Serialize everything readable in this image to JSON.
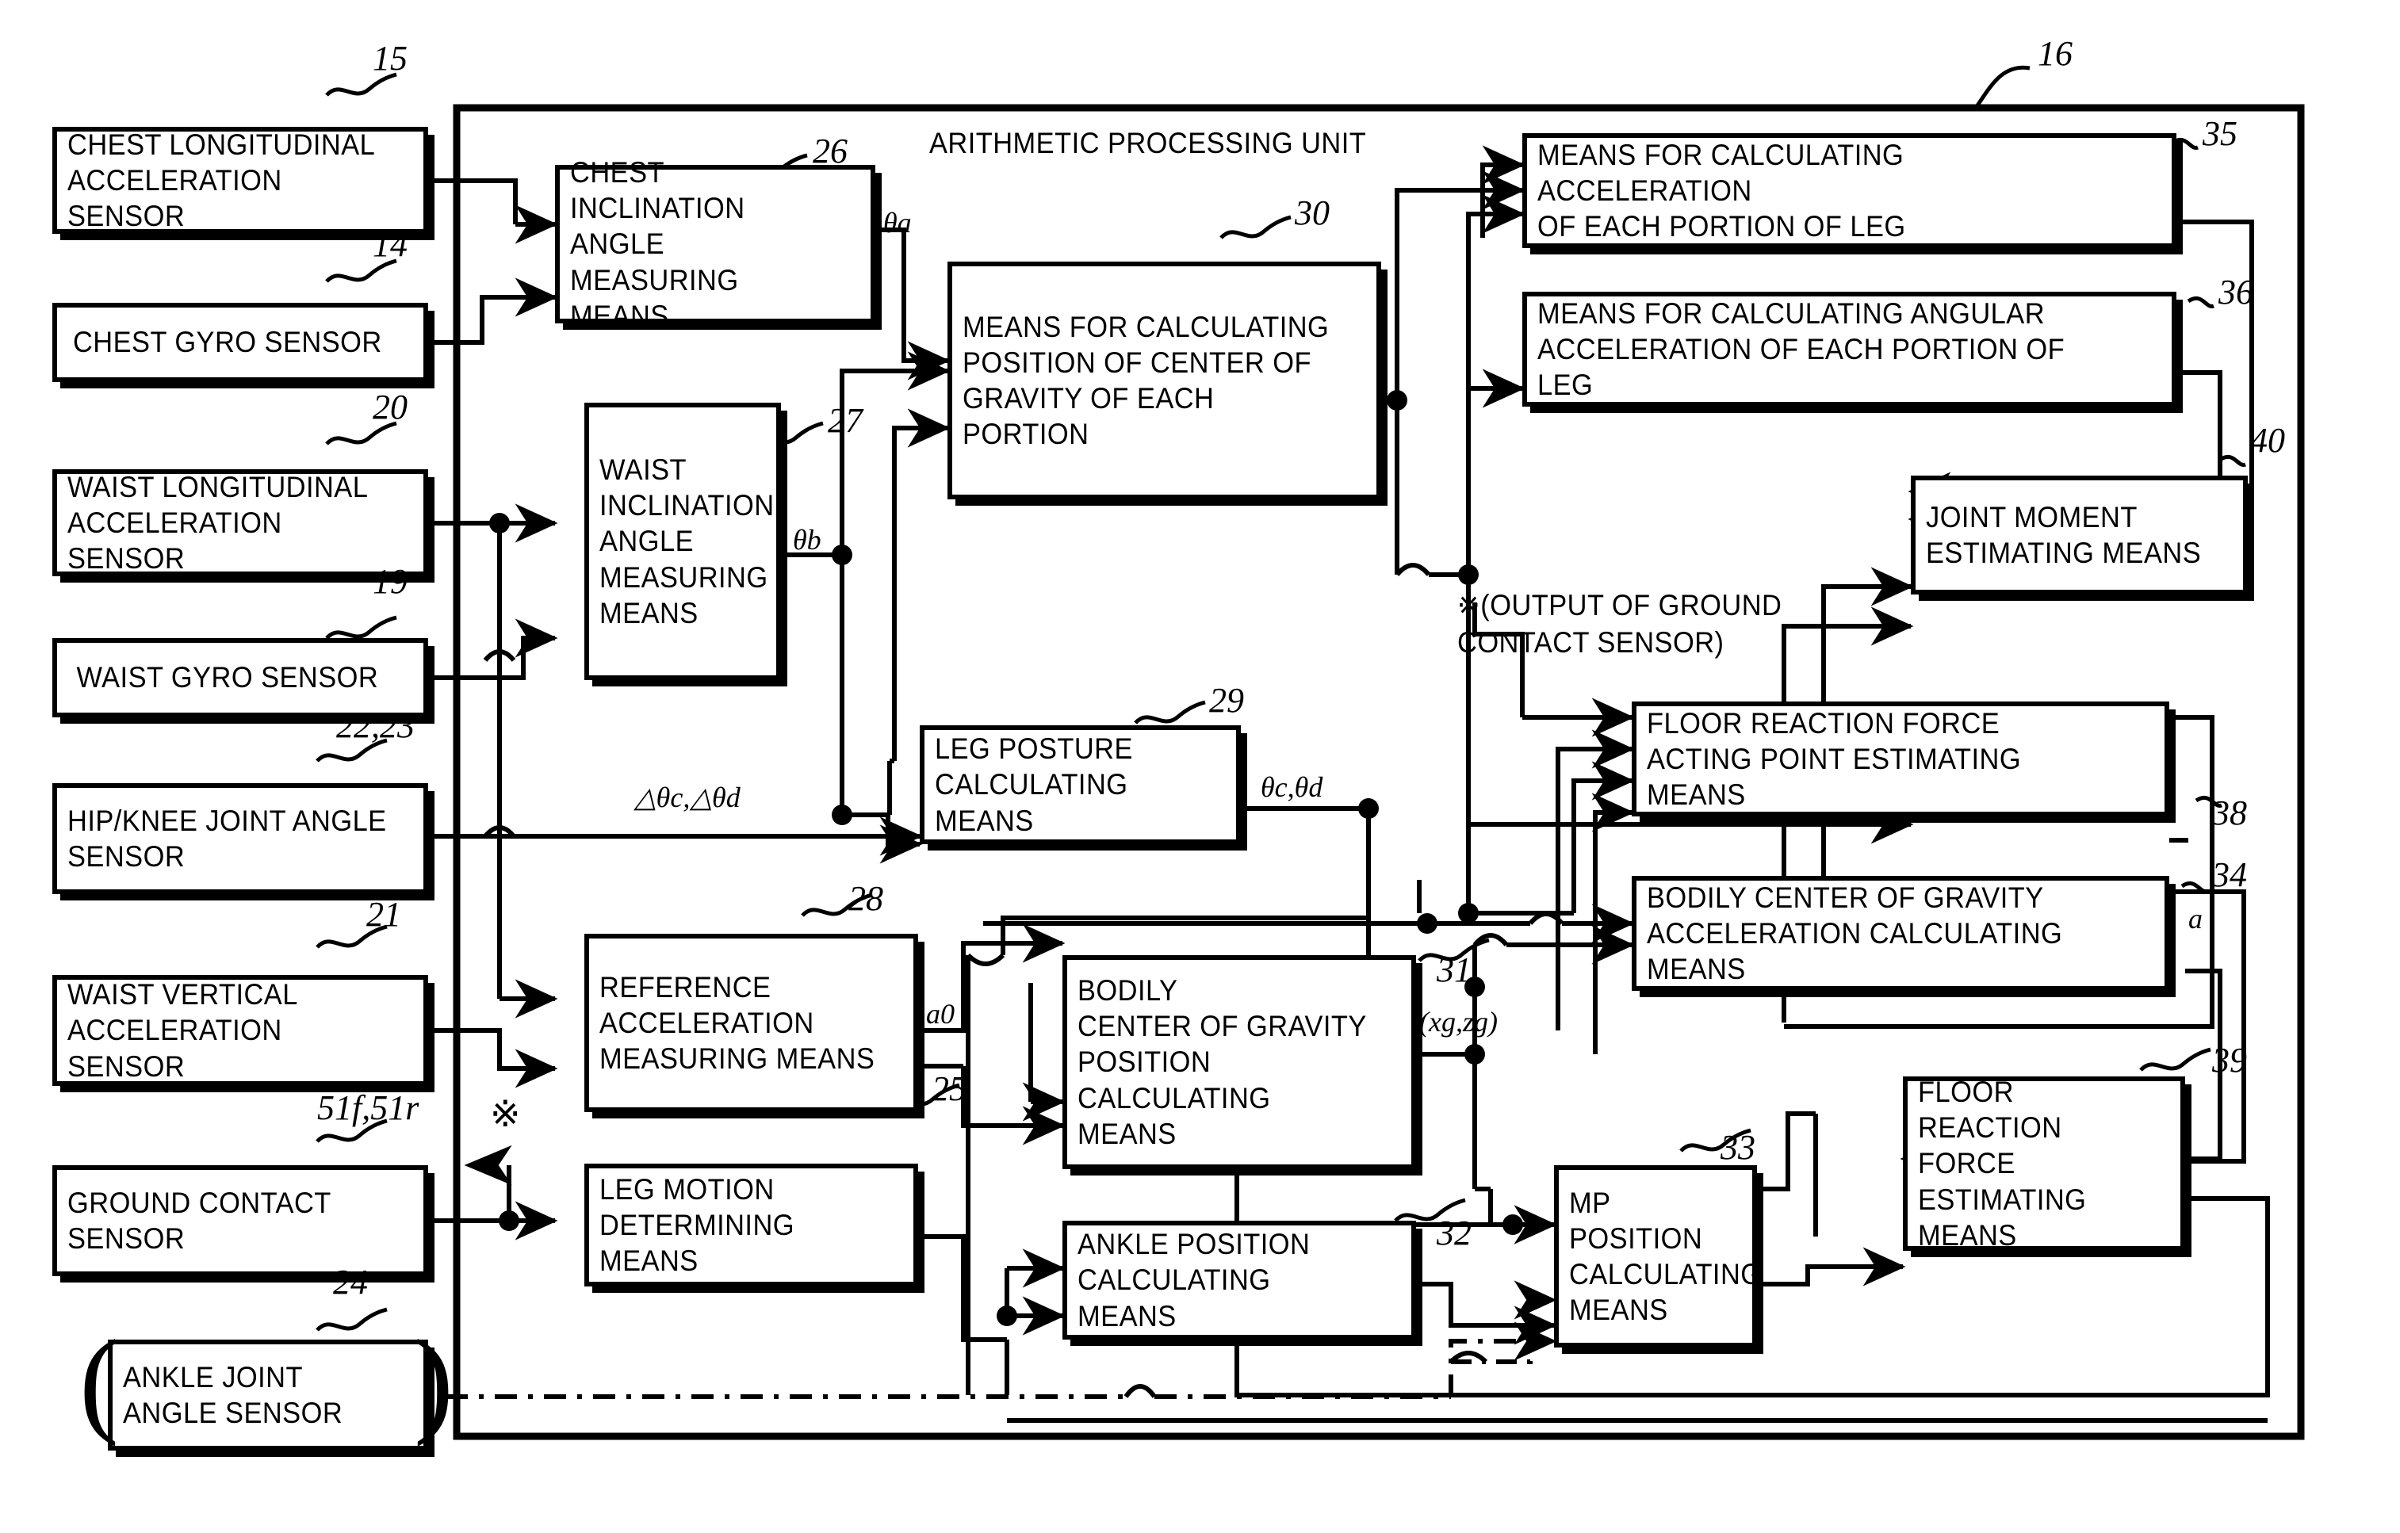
{
  "title_label": "ARITHMETIC PROCESSING UNIT",
  "unit_ref": "16",
  "sensors": [
    {
      "id": "chest-longitudinal-acceleration-sensor",
      "label": "CHEST LONGITUDINAL\nACCELERATION SENSOR",
      "ref": "15"
    },
    {
      "id": "chest-gyro-sensor",
      "label": "CHEST GYRO SENSOR",
      "ref": "14"
    },
    {
      "id": "waist-longitudinal-acceleration-sensor",
      "label": "WAIST LONGITUDINAL\nACCELERATION SENSOR",
      "ref": "20"
    },
    {
      "id": "waist-gyro-sensor",
      "label": "WAIST GYRO SENSOR",
      "ref": "19"
    },
    {
      "id": "hip-knee-joint-angle-sensor",
      "label": "HIP/KNEE JOINT ANGLE\nSENSOR",
      "ref": "22,23"
    },
    {
      "id": "waist-vertical-acceleration-sensor",
      "label": "WAIST VERTICAL\nACCELERATION SENSOR",
      "ref": "21"
    },
    {
      "id": "ground-contact-sensor",
      "label": "GROUND CONTACT\nSENSOR",
      "ref": "51f,51r"
    },
    {
      "id": "ankle-joint-angle-sensor",
      "label": "ANKLE JOINT\nANGLE SENSOR",
      "ref": "24"
    }
  ],
  "blocks": [
    {
      "id": "chest-inclination-angle-measuring-means",
      "label": "CHEST INCLINATION\nANGLE MEASURING\nMEANS",
      "ref": "26"
    },
    {
      "id": "waist-inclination-angle-measuring-means",
      "label": "WAIST\nINCLINATION\nANGLE\nMEASURING\nMEANS",
      "ref": "27"
    },
    {
      "id": "means-for-calculating-position-of-center-of-gravity-of-each-portion",
      "label": "MEANS FOR CALCULATING\nPOSITION OF CENTER OF\nGRAVITY OF EACH PORTION",
      "ref": "30"
    },
    {
      "id": "means-for-calculating-acceleration-of-each-portion-of-leg",
      "label": "MEANS FOR CALCULATING ACCELERATION\nOF EACH PORTION OF LEG",
      "ref": "35"
    },
    {
      "id": "means-for-calculating-angular-acceleration-of-each-portion-of-leg",
      "label": "MEANS FOR CALCULATING ANGULAR\nACCELERATION OF EACH PORTION OF LEG",
      "ref": "36"
    },
    {
      "id": "joint-moment-estimating-means",
      "label": "JOINT MOMENT\nESTIMATING MEANS",
      "ref": "40"
    },
    {
      "id": "leg-posture-calculating-means",
      "label": "LEG POSTURE\nCALCULATING MEANS",
      "ref": "29"
    },
    {
      "id": "floor-reaction-force-acting-point-estimating-means",
      "label": "FLOOR REACTION FORCE\nACTING POINT ESTIMATING MEANS",
      "ref": "38"
    },
    {
      "id": "bodily-center-of-gravity-acceleration-calculating-means",
      "label": "BODILY CENTER OF GRAVITY\nACCELERATION CALCULATING MEANS",
      "ref": "34"
    },
    {
      "id": "reference-acceleration-measuring-means",
      "label": "REFERENCE\nACCELERATION\nMEASURING MEANS",
      "ref": "28"
    },
    {
      "id": "bodily-center-of-gravity-position-calculating-means",
      "label": "BODILY\nCENTER OF GRAVITY\nPOSITION\nCALCULATING MEANS",
      "ref": "31"
    },
    {
      "id": "leg-motion-determining-means",
      "label": "LEG MOTION\nDETERMINING MEANS",
      "ref": "25"
    },
    {
      "id": "ankle-position-calculating-means",
      "label": "ANKLE POSITION\nCALCULATING MEANS",
      "ref": "32"
    },
    {
      "id": "mp-position-calculating-means",
      "label": "MP POSITION\nCALCULATING\nMEANS",
      "ref": "33"
    },
    {
      "id": "floor-reaction-force-estimating-means",
      "label": "FLOOR REACTION\nFORCE ESTIMATING\nMEANS",
      "ref": "39"
    }
  ],
  "signal_labels": {
    "theta_a": "θa",
    "theta_b": "θb",
    "delta_theta_cd": "△θc,△θd",
    "theta_cd": "θc,θd",
    "a0": "a0",
    "xg_zg": "(xg,zg)",
    "a": "a"
  },
  "annotations": {
    "ground_contact_note": "※(OUTPUT OF GROUND\n      CONTACT SENSOR)",
    "star_symbol": "※"
  },
  "colors": {
    "ink": "#000000",
    "paper": "#ffffff"
  }
}
